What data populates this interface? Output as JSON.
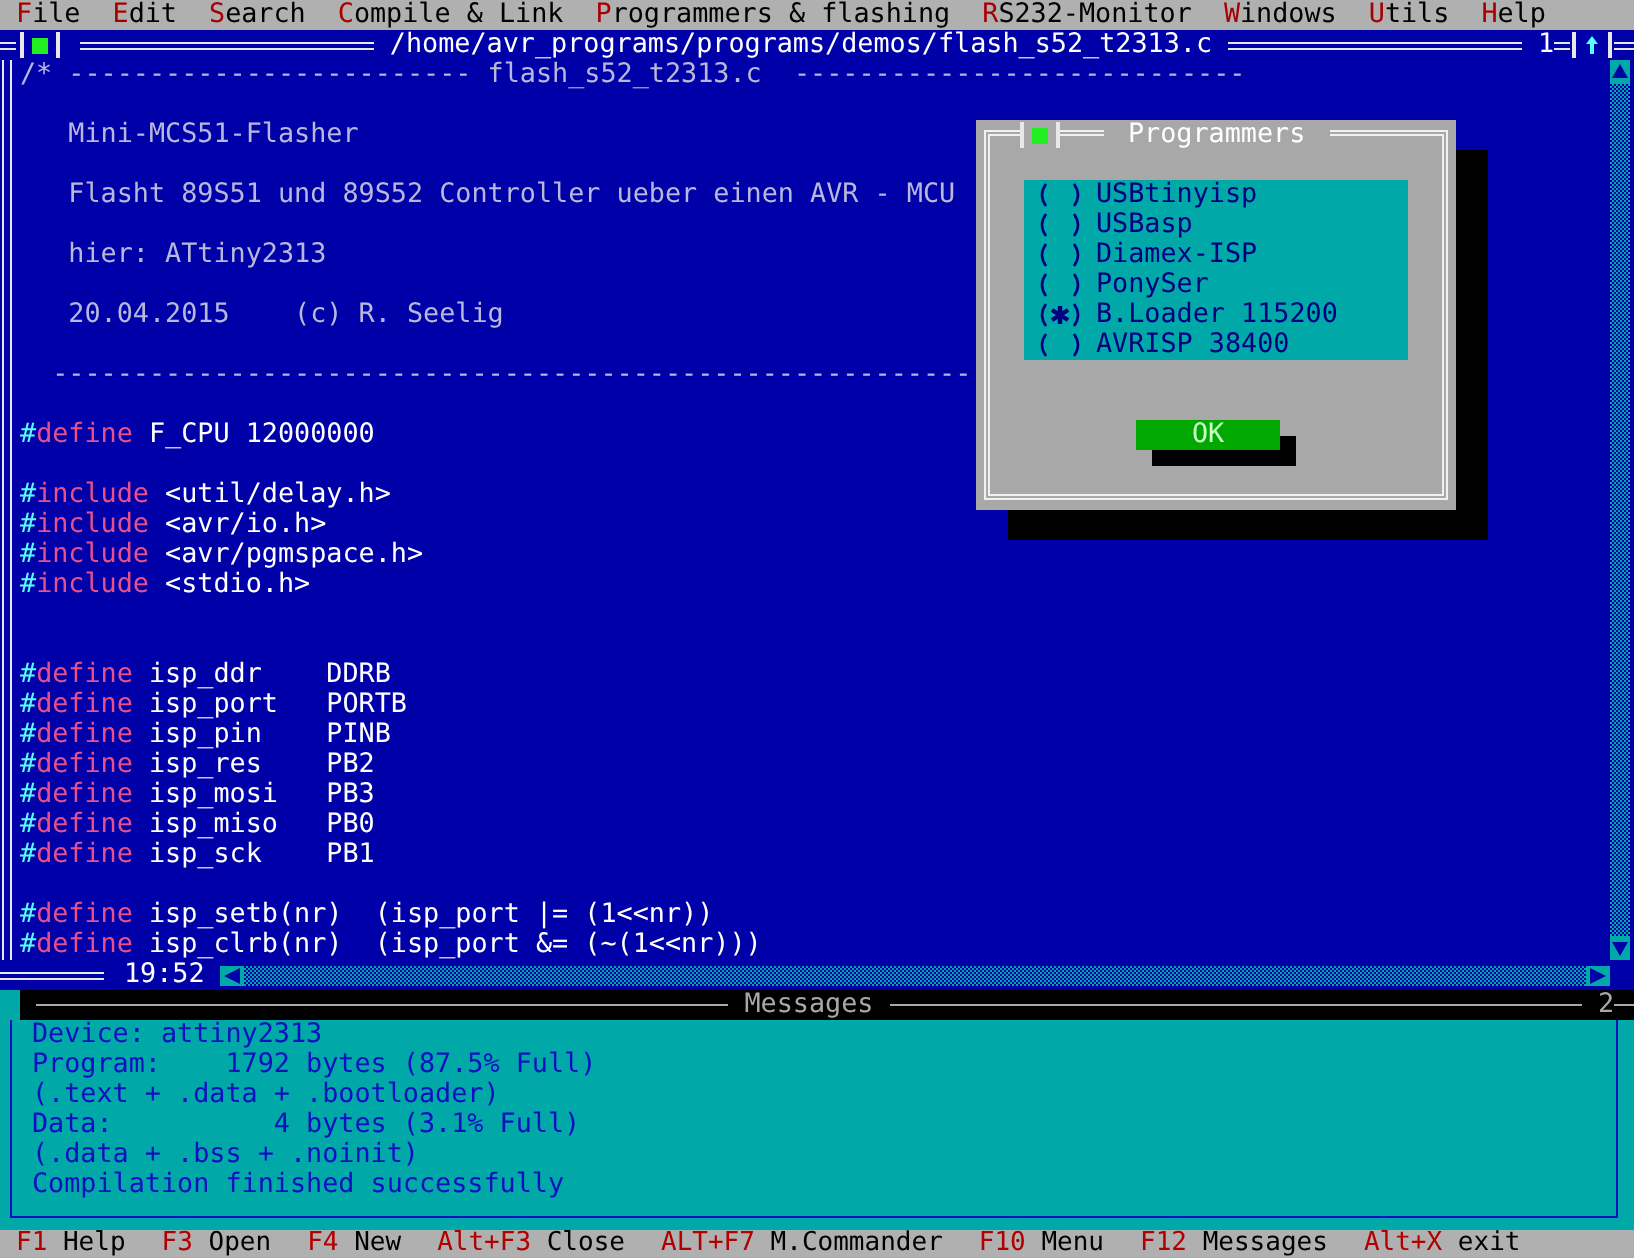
{
  "menu": [
    {
      "hotkey": "F",
      "rest": "ile"
    },
    {
      "hotkey": "E",
      "rest": "dit"
    },
    {
      "hotkey": "S",
      "rest": "earch"
    },
    {
      "hotkey": "C",
      "rest": "ompile & Link"
    },
    {
      "hotkey": "P",
      "rest": "rogrammers & flashing"
    },
    {
      "hotkey": "R",
      "rest": "S232-Monitor"
    },
    {
      "hotkey": "W",
      "rest": "indows"
    },
    {
      "hotkey": "U",
      "rest": "tils"
    },
    {
      "hotkey": "H",
      "rest": "elp"
    }
  ],
  "editor": {
    "title": "/home/avr_programs/programs/demos/flash_s52_t2313.c",
    "window_number": "1",
    "time": "19:52",
    "lines": [
      {
        "kind": "comment",
        "text": "/* ------------------------- flash_s52_t2313.c  ----------------------------"
      },
      {
        "kind": "blank"
      },
      {
        "kind": "comment",
        "text": "   Mini-MCS51-Flasher"
      },
      {
        "kind": "blank"
      },
      {
        "kind": "comment",
        "text": "   Flasht 89S51 und 89S52 Controller ueber einen AVR - MCU"
      },
      {
        "kind": "blank"
      },
      {
        "kind": "comment",
        "text": "   hier: ATtiny2313"
      },
      {
        "kind": "blank"
      },
      {
        "kind": "comment",
        "text": "   20.04.2015    (c) R. Seelig"
      },
      {
        "kind": "blank"
      },
      {
        "kind": "comment",
        "text": "  ---------------------------------------------------------"
      },
      {
        "kind": "blank"
      },
      {
        "kind": "directive",
        "hash": "#",
        "keyword": "define",
        "text": " F_CPU 12000000"
      },
      {
        "kind": "blank"
      },
      {
        "kind": "directive",
        "hash": "#",
        "keyword": "include",
        "text": " <util/delay.h>"
      },
      {
        "kind": "directive",
        "hash": "#",
        "keyword": "include",
        "text": " <avr/io.h>"
      },
      {
        "kind": "directive",
        "hash": "#",
        "keyword": "include",
        "text": " <avr/pgmspace.h>"
      },
      {
        "kind": "directive",
        "hash": "#",
        "keyword": "include",
        "text": " <stdio.h>"
      },
      {
        "kind": "blank"
      },
      {
        "kind": "blank"
      },
      {
        "kind": "directive",
        "hash": "#",
        "keyword": "define",
        "text": " isp_ddr    DDRB"
      },
      {
        "kind": "directive",
        "hash": "#",
        "keyword": "define",
        "text": " isp_port   PORTB"
      },
      {
        "kind": "directive",
        "hash": "#",
        "keyword": "define",
        "text": " isp_pin    PINB"
      },
      {
        "kind": "directive",
        "hash": "#",
        "keyword": "define",
        "text": " isp_res    PB2"
      },
      {
        "kind": "directive",
        "hash": "#",
        "keyword": "define",
        "text": " isp_mosi   PB3"
      },
      {
        "kind": "directive",
        "hash": "#",
        "keyword": "define",
        "text": " isp_miso   PB0"
      },
      {
        "kind": "directive",
        "hash": "#",
        "keyword": "define",
        "text": " isp_sck    PB1"
      },
      {
        "kind": "blank"
      },
      {
        "kind": "directive",
        "hash": "#",
        "keyword": "define",
        "text": " isp_setb(nr)  (isp_port |= (1<<nr))"
      },
      {
        "kind": "directive",
        "hash": "#",
        "keyword": "define",
        "text": " isp_clrb(nr)  (isp_port &= (~(1<<nr)))"
      }
    ]
  },
  "dialog": {
    "title": "Programmers",
    "options": [
      {
        "label": "USBtinyisp",
        "selected": false
      },
      {
        "label": "USBasp",
        "selected": false
      },
      {
        "label": "Diamex-ISP",
        "selected": false
      },
      {
        "label": "PonySer",
        "selected": false
      },
      {
        "label": "B.Loader 115200",
        "selected": true
      },
      {
        "label": "AVRISP 38400",
        "selected": false
      }
    ],
    "ok_button": "OK"
  },
  "messages": {
    "title": "Messages",
    "window_number": "2",
    "lines": [
      "Device: attiny2313",
      "Program:    1792 bytes (87.5% Full)",
      "(.text + .data + .bootloader)",
      "Data:          4 bytes (3.1% Full)",
      "(.data + .bss + .noinit)",
      "Compilation finished successfully"
    ]
  },
  "status_bar": [
    {
      "key": "F1",
      "label": "Help"
    },
    {
      "key": "F3",
      "label": "Open"
    },
    {
      "key": "F4",
      "label": "New"
    },
    {
      "key": "Alt+F3",
      "label": "Close"
    },
    {
      "key": "ALT+F7",
      "label": "M.Commander"
    },
    {
      "key": "F10",
      "label": "Menu"
    },
    {
      "key": "F12",
      "label": "Messages"
    },
    {
      "key": "Alt+X",
      "label": "exit"
    }
  ]
}
